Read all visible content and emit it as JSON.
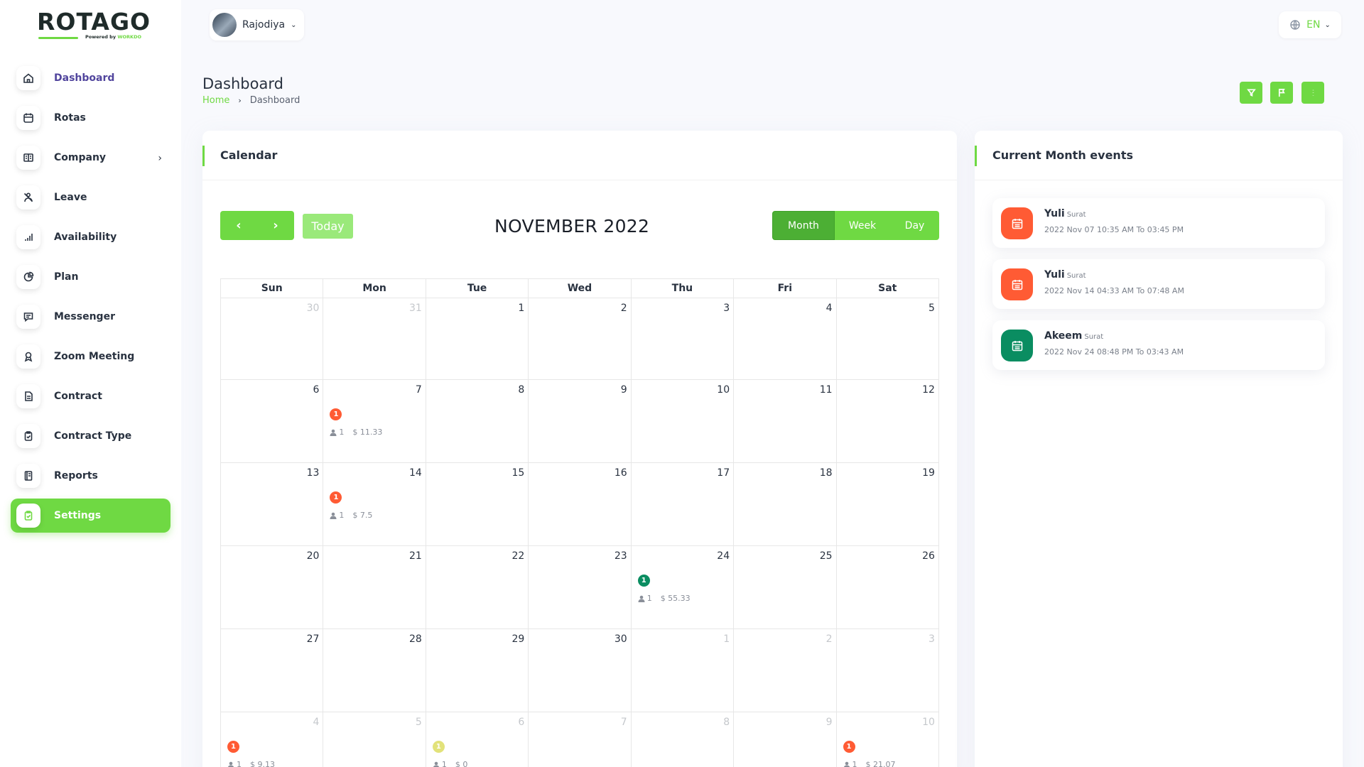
{
  "brand": {
    "logo_text": "ROTAGO",
    "logo_sub": "Powered by",
    "logo_sub_brand": "WORKDO"
  },
  "user": {
    "name": "Rajodiya"
  },
  "language": {
    "code": "EN"
  },
  "sidebar": {
    "items": [
      {
        "label": "Dashboard",
        "icon": "home-icon"
      },
      {
        "label": "Rotas",
        "icon": "calendar-icon"
      },
      {
        "label": "Company",
        "icon": "book-icon"
      },
      {
        "label": "Leave",
        "icon": "leave-icon"
      },
      {
        "label": "Availability",
        "icon": "chart-icon"
      },
      {
        "label": "Plan",
        "icon": "pie-icon"
      },
      {
        "label": "Messenger",
        "icon": "message-icon"
      },
      {
        "label": "Zoom Meeting",
        "icon": "award-icon"
      },
      {
        "label": "Contract",
        "icon": "file-icon"
      },
      {
        "label": "Contract Type",
        "icon": "clipboard-icon"
      },
      {
        "label": "Reports",
        "icon": "report-icon"
      },
      {
        "label": "Settings",
        "icon": "settings-icon"
      }
    ]
  },
  "page": {
    "title": "Dashboard"
  },
  "breadcrumb": {
    "home": "Home",
    "current": "Dashboard"
  },
  "calendar": {
    "card_title": "Calendar",
    "title": "NOVEMBER 2022",
    "today_label": "Today",
    "views": {
      "month": "Month",
      "week": "Week",
      "day": "Day"
    },
    "days_of_week": [
      "Sun",
      "Mon",
      "Tue",
      "Wed",
      "Thu",
      "Fri",
      "Sat"
    ],
    "weeks": [
      [
        {
          "d": "30",
          "o": true
        },
        {
          "d": "31",
          "o": true
        },
        {
          "d": "1"
        },
        {
          "d": "2"
        },
        {
          "d": "3"
        },
        {
          "d": "4"
        },
        {
          "d": "5"
        }
      ],
      [
        {
          "d": "6"
        },
        {
          "d": "7",
          "ev": {
            "count": "1",
            "people": "1",
            "amount": "$ 11.33",
            "color": "#ff5b34"
          }
        },
        {
          "d": "8"
        },
        {
          "d": "9"
        },
        {
          "d": "10"
        },
        {
          "d": "11"
        },
        {
          "d": "12"
        }
      ],
      [
        {
          "d": "13"
        },
        {
          "d": "14",
          "ev": {
            "count": "1",
            "people": "1",
            "amount": "$ 7.5",
            "color": "#ff5b34"
          }
        },
        {
          "d": "15"
        },
        {
          "d": "16"
        },
        {
          "d": "17"
        },
        {
          "d": "18"
        },
        {
          "d": "19"
        }
      ],
      [
        {
          "d": "20"
        },
        {
          "d": "21"
        },
        {
          "d": "22"
        },
        {
          "d": "23"
        },
        {
          "d": "24",
          "ev": {
            "count": "1",
            "people": "1",
            "amount": "$ 55.33",
            "color": "#0a8d61"
          }
        },
        {
          "d": "25"
        },
        {
          "d": "26"
        }
      ],
      [
        {
          "d": "27"
        },
        {
          "d": "28"
        },
        {
          "d": "29"
        },
        {
          "d": "30"
        },
        {
          "d": "1",
          "o": true
        },
        {
          "d": "2",
          "o": true
        },
        {
          "d": "3",
          "o": true
        }
      ],
      [
        {
          "d": "4",
          "o": true,
          "ev": {
            "count": "1",
            "people": "1",
            "amount": "$ 9.13",
            "color": "#ff5b34"
          }
        },
        {
          "d": "5",
          "o": true
        },
        {
          "d": "6",
          "o": true,
          "ev": {
            "count": "1",
            "people": "1",
            "amount": "$ 0",
            "color": "#e2e27a"
          }
        },
        {
          "d": "7",
          "o": true
        },
        {
          "d": "8",
          "o": true
        },
        {
          "d": "9",
          "o": true
        },
        {
          "d": "10",
          "o": true,
          "ev": {
            "count": "1",
            "people": "1",
            "amount": "$ 21.07",
            "color": "#ff5b34"
          }
        }
      ]
    ]
  },
  "events": {
    "card_title": "Current Month events",
    "items": [
      {
        "name": "Yuli",
        "location": "Surat",
        "time": "2022 Nov 07 10:35 AM To 03:45 PM",
        "color": "#ff5b34"
      },
      {
        "name": "Yuli",
        "location": "Surat",
        "time": "2022 Nov 14 04:33 AM To 07:48 AM",
        "color": "#ff5b34"
      },
      {
        "name": "Akeem",
        "location": "Surat",
        "time": "2022 Nov 24 08:48 PM To 03:43 AM",
        "color": "#0a8d61"
      }
    ]
  },
  "colors": {
    "accent": "#6fd943",
    "accent_dark": "#4caf34",
    "event_red": "#ff5b34",
    "event_green": "#0a8d61"
  }
}
